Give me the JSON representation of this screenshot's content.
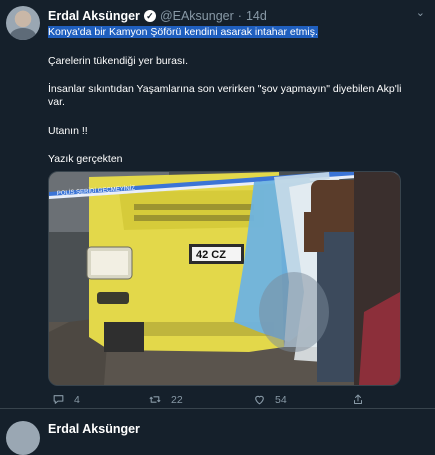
{
  "tweet": {
    "author_name": "Erdal Aksünger",
    "handle": "@EAksunger",
    "separator": "·",
    "time": "14d",
    "lines": [
      "Konya'da bir Kamyon Şöförü kendini asarak intahar etmiş.",
      "Çarelerin tükendiği yer burası.",
      "İnsanlar sıkıntıdan Yaşamlarına son verirken \"şov yapmayın\" diyebilen Akp'li",
      "var.",
      "Utanın !!",
      "Yazık gerçekten"
    ],
    "media": {
      "plate_text": "42 CZ",
      "tape_text": "POLİS ŞERİDİ GEÇMEYİNİZ"
    },
    "stats": {
      "replies": "4",
      "retweets": "22",
      "likes": "54"
    },
    "icons": [
      "verified-badge-icon",
      "chevron-down-icon",
      "reply-icon",
      "retweet-icon",
      "like-icon",
      "share-icon"
    ]
  },
  "next_tweet": {
    "author_name": "Erdal Aksünger"
  }
}
